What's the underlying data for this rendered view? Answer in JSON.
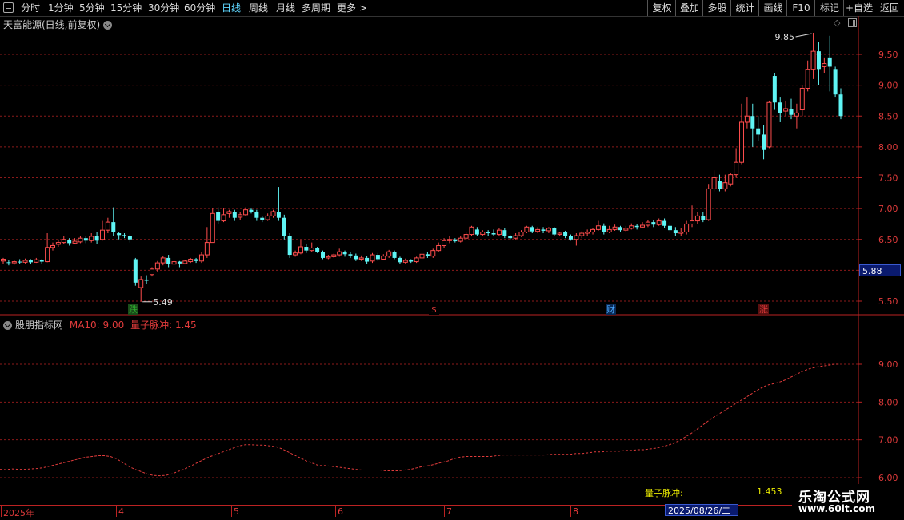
{
  "toolbar": {
    "periods": [
      "分时",
      "1分钟",
      "5分钟",
      "15分钟",
      "30分钟",
      "60分钟",
      "日线",
      "周线",
      "月线",
      "多周期",
      "更多 >"
    ],
    "active_period": "日线",
    "right_buttons": [
      "复权",
      "叠加",
      "多股",
      "统计",
      "画线",
      "F10",
      "标记",
      "+自选",
      "返回"
    ]
  },
  "main_panel": {
    "title": "天富能源(日线,前复权)",
    "high_annotation": "9.85",
    "low_annotation": "5.49",
    "current_price": "5.88",
    "y_ticks": [
      "9.50",
      "9.00",
      "8.50",
      "8.00",
      "7.50",
      "7.00",
      "6.50",
      "6.00",
      "5.50"
    ],
    "events": [
      {
        "label": "跌",
        "color": "#2ea82e",
        "bg": "#1a4d1a"
      },
      {
        "label": "$",
        "color": "#e03b3b",
        "bg": "#000"
      },
      {
        "label": "财",
        "color": "#4aa8ff",
        "bg": "#0a2a55"
      },
      {
        "label": "涨",
        "color": "#e03b3b",
        "bg": "#5a1010"
      }
    ]
  },
  "indicator_panel": {
    "name": "股朋指标网",
    "ma_label": "MA10: 9.00",
    "pulse_label": "量子脉冲: 1.45",
    "y_ticks": [
      "9.00",
      "8.00",
      "7.00",
      "6.00"
    ],
    "readout_label": "量子脉冲:",
    "readout_value": "1.453"
  },
  "date_axis": {
    "labels": [
      "2025年",
      "4",
      "5",
      "6",
      "7",
      "8"
    ],
    "cursor_date": "2025/08/26/二"
  },
  "watermark": {
    "title": "乐淘公式网",
    "url": "www.60lt.com"
  },
  "colors": {
    "up": "#ff4d4d",
    "down": "#5ff5f5",
    "grid": "#8b1a1a",
    "ma_line": "#e03b3b"
  },
  "chart_data": {
    "type": "candlestick",
    "price_range": [
      5.3,
      9.9
    ],
    "candles": [
      [
        6.15,
        6.18,
        6.1,
        6.2
      ],
      [
        6.13,
        6.12,
        6.08,
        6.16
      ],
      [
        6.12,
        6.14,
        6.09,
        6.17
      ],
      [
        6.14,
        6.13,
        6.1,
        6.18
      ],
      [
        6.13,
        6.16,
        6.11,
        6.19
      ],
      [
        6.16,
        6.13,
        6.1,
        6.18
      ],
      [
        6.13,
        6.17,
        6.12,
        6.2
      ],
      [
        6.17,
        6.14,
        6.11,
        6.18
      ],
      [
        6.14,
        6.37,
        6.13,
        6.6
      ],
      [
        6.37,
        6.4,
        6.32,
        6.45
      ],
      [
        6.42,
        6.45,
        6.38,
        6.5
      ],
      [
        6.45,
        6.5,
        6.42,
        6.55
      ],
      [
        6.49,
        6.44,
        6.4,
        6.52
      ],
      [
        6.44,
        6.47,
        6.42,
        6.52
      ],
      [
        6.46,
        6.52,
        6.44,
        6.56
      ],
      [
        6.52,
        6.48,
        6.44,
        6.55
      ],
      [
        6.48,
        6.55,
        6.45,
        6.6
      ],
      [
        6.55,
        6.48,
        6.42,
        6.62
      ],
      [
        6.5,
        6.65,
        6.48,
        6.8
      ],
      [
        6.65,
        6.78,
        6.6,
        6.85
      ],
      [
        6.78,
        6.62,
        6.55,
        7.02
      ],
      [
        6.6,
        6.57,
        6.5,
        6.62
      ],
      [
        6.57,
        6.55,
        6.52,
        6.6
      ],
      [
        6.55,
        6.5,
        6.45,
        6.58
      ],
      [
        6.18,
        5.8,
        5.75,
        6.2
      ],
      [
        5.72,
        5.85,
        5.49,
        5.9
      ],
      [
        5.85,
        5.83,
        5.78,
        5.92
      ],
      [
        5.93,
        6.02,
        5.9,
        6.05
      ],
      [
        6.02,
        6.12,
        5.98,
        6.15
      ],
      [
        6.12,
        6.2,
        6.08,
        6.23
      ],
      [
        6.2,
        6.1,
        6.05,
        6.25
      ],
      [
        6.1,
        6.14,
        6.08,
        6.17
      ],
      [
        6.14,
        6.11,
        6.05,
        6.15
      ],
      [
        6.11,
        6.15,
        6.1,
        6.17
      ],
      [
        6.14,
        6.18,
        6.12,
        6.2
      ],
      [
        6.18,
        6.15,
        6.12,
        6.2
      ],
      [
        6.15,
        6.25,
        6.12,
        6.3
      ],
      [
        6.25,
        6.45,
        6.2,
        6.7
      ],
      [
        6.45,
        6.92,
        6.45,
        7.0
      ],
      [
        6.95,
        6.8,
        6.75,
        7.02
      ],
      [
        6.8,
        6.9,
        6.78,
        7.0
      ],
      [
        6.92,
        6.95,
        6.85,
        6.98
      ],
      [
        6.95,
        6.85,
        6.8,
        6.98
      ],
      [
        6.86,
        6.9,
        6.82,
        6.95
      ],
      [
        6.9,
        6.98,
        6.88,
        7.02
      ],
      [
        6.98,
        6.95,
        6.92,
        7.0
      ],
      [
        6.95,
        6.85,
        6.8,
        6.98
      ],
      [
        6.85,
        6.82,
        6.78,
        6.88
      ],
      [
        6.82,
        6.88,
        6.8,
        6.92
      ],
      [
        6.88,
        6.95,
        6.85,
        6.98
      ],
      [
        6.95,
        6.85,
        6.8,
        7.35
      ],
      [
        6.85,
        6.55,
        6.5,
        6.9
      ],
      [
        6.55,
        6.25,
        6.2,
        6.6
      ],
      [
        6.25,
        6.28,
        6.22,
        6.32
      ],
      [
        6.28,
        6.38,
        6.26,
        6.5
      ],
      [
        6.38,
        6.32,
        6.28,
        6.42
      ],
      [
        6.32,
        6.36,
        6.3,
        6.45
      ],
      [
        6.36,
        6.3,
        6.28,
        6.38
      ],
      [
        6.3,
        6.2,
        6.18,
        6.32
      ],
      [
        6.2,
        6.22,
        6.18,
        6.25
      ],
      [
        6.22,
        6.25,
        6.2,
        6.27
      ],
      [
        6.25,
        6.3,
        6.22,
        6.35
      ],
      [
        6.3,
        6.26,
        6.22,
        6.32
      ],
      [
        6.26,
        6.24,
        6.2,
        6.3
      ],
      [
        6.24,
        6.18,
        6.15,
        6.27
      ],
      [
        6.18,
        6.2,
        6.15,
        6.24
      ],
      [
        6.2,
        6.14,
        6.1,
        6.23
      ],
      [
        6.15,
        6.25,
        6.12,
        6.28
      ],
      [
        6.25,
        6.18,
        6.15,
        6.28
      ],
      [
        6.18,
        6.23,
        6.16,
        6.26
      ],
      [
        6.23,
        6.3,
        6.2,
        6.33
      ],
      [
        6.3,
        6.2,
        6.18,
        6.32
      ],
      [
        6.2,
        6.13,
        6.1,
        6.22
      ],
      [
        6.13,
        6.16,
        6.1,
        6.19
      ],
      [
        6.16,
        6.14,
        6.12,
        6.18
      ],
      [
        6.14,
        6.2,
        6.12,
        6.22
      ],
      [
        6.2,
        6.26,
        6.18,
        6.29
      ],
      [
        6.26,
        6.23,
        6.2,
        6.29
      ],
      [
        6.23,
        6.32,
        6.2,
        6.35
      ],
      [
        6.32,
        6.4,
        6.3,
        6.45
      ],
      [
        6.4,
        6.48,
        6.36,
        6.52
      ],
      [
        6.48,
        6.5,
        6.44,
        6.55
      ],
      [
        6.5,
        6.47,
        6.45,
        6.52
      ],
      [
        6.47,
        6.52,
        6.45,
        6.55
      ],
      [
        6.52,
        6.58,
        6.5,
        6.62
      ],
      [
        6.58,
        6.7,
        6.55,
        6.72
      ],
      [
        6.66,
        6.58,
        6.55,
        6.7
      ],
      [
        6.58,
        6.62,
        6.56,
        6.65
      ],
      [
        6.62,
        6.6,
        6.56,
        6.65
      ],
      [
        6.6,
        6.58,
        6.55,
        6.66
      ],
      [
        6.58,
        6.65,
        6.56,
        6.68
      ],
      [
        6.65,
        6.55,
        6.52,
        6.68
      ],
      [
        6.55,
        6.52,
        6.5,
        6.57
      ],
      [
        6.52,
        6.56,
        6.5,
        6.6
      ],
      [
        6.56,
        6.62,
        6.54,
        6.65
      ],
      [
        6.62,
        6.7,
        6.6,
        6.72
      ],
      [
        6.7,
        6.63,
        6.6,
        6.72
      ],
      [
        6.63,
        6.66,
        6.6,
        6.7
      ],
      [
        6.66,
        6.64,
        6.6,
        6.7
      ],
      [
        6.64,
        6.68,
        6.6,
        6.7
      ],
      [
        6.68,
        6.58,
        6.55,
        6.7
      ],
      [
        6.58,
        6.6,
        6.55,
        6.62
      ],
      [
        6.62,
        6.55,
        6.52,
        6.64
      ],
      [
        6.55,
        6.5,
        6.48,
        6.58
      ],
      [
        6.5,
        6.56,
        6.4,
        6.6
      ],
      [
        6.56,
        6.6,
        6.52,
        6.63
      ],
      [
        6.6,
        6.62,
        6.56,
        6.66
      ],
      [
        6.62,
        6.66,
        6.58,
        6.68
      ],
      [
        6.66,
        6.72,
        6.64,
        6.8
      ],
      [
        6.72,
        6.62,
        6.58,
        6.76
      ],
      [
        6.62,
        6.66,
        6.6,
        6.72
      ],
      [
        6.66,
        6.7,
        6.64,
        6.74
      ],
      [
        6.7,
        6.65,
        6.62,
        6.72
      ],
      [
        6.65,
        6.68,
        6.62,
        6.72
      ],
      [
        6.68,
        6.72,
        6.66,
        6.76
      ],
      [
        6.72,
        6.7,
        6.66,
        6.75
      ],
      [
        6.7,
        6.73,
        6.68,
        6.78
      ],
      [
        6.73,
        6.78,
        6.7,
        6.82
      ],
      [
        6.78,
        6.74,
        6.7,
        6.82
      ],
      [
        6.74,
        6.8,
        6.72,
        6.84
      ],
      [
        6.8,
        6.72,
        6.68,
        6.84
      ],
      [
        6.72,
        6.65,
        6.6,
        6.78
      ],
      [
        6.65,
        6.6,
        6.55,
        6.7
      ],
      [
        6.6,
        6.62,
        6.56,
        6.68
      ],
      [
        6.62,
        6.75,
        6.58,
        6.8
      ],
      [
        6.75,
        6.8,
        6.7,
        7.05
      ],
      [
        6.8,
        6.88,
        6.75,
        6.95
      ],
      [
        6.88,
        6.82,
        6.78,
        6.94
      ],
      [
        6.82,
        7.32,
        6.8,
        7.4
      ],
      [
        7.32,
        7.5,
        7.28,
        7.62
      ],
      [
        7.45,
        7.32,
        7.28,
        7.55
      ],
      [
        7.32,
        7.42,
        7.28,
        7.55
      ],
      [
        7.4,
        7.55,
        7.36,
        7.58
      ],
      [
        7.55,
        7.75,
        7.5,
        7.98
      ],
      [
        7.75,
        8.4,
        7.72,
        8.7
      ],
      [
        8.4,
        8.5,
        8.3,
        8.8
      ],
      [
        8.5,
        8.3,
        8.0,
        8.7
      ],
      [
        8.3,
        8.2,
        8.1,
        8.5
      ],
      [
        8.2,
        7.95,
        7.8,
        8.35
      ],
      [
        8.0,
        8.72,
        7.98,
        8.75
      ],
      [
        9.15,
        8.72,
        8.6,
        9.2
      ],
      [
        8.72,
        8.55,
        8.4,
        8.8
      ],
      [
        8.58,
        8.62,
        8.5,
        8.75
      ],
      [
        8.62,
        8.52,
        8.45,
        8.78
      ],
      [
        8.5,
        8.55,
        8.3,
        8.7
      ],
      [
        8.6,
        8.95,
        8.5,
        9.0
      ],
      [
        8.95,
        9.25,
        8.9,
        9.4
      ],
      [
        9.25,
        9.55,
        9.1,
        9.85
      ],
      [
        9.55,
        9.25,
        9.0,
        9.7
      ],
      [
        9.3,
        9.35,
        9.2,
        9.45
      ],
      [
        9.45,
        9.3,
        8.9,
        9.8
      ],
      [
        9.25,
        8.85,
        8.8,
        9.3
      ],
      [
        8.85,
        8.5,
        8.45,
        8.95
      ]
    ],
    "ma10_curve": [
      6.22,
      6.21,
      6.23,
      6.22,
      6.22,
      6.23,
      6.24,
      6.26,
      6.3,
      6.34,
      6.38,
      6.42,
      6.46,
      6.5,
      6.54,
      6.56,
      6.58,
      6.58,
      6.56,
      6.5,
      6.4,
      6.3,
      6.22,
      6.16,
      6.1,
      6.06,
      6.05,
      6.06,
      6.1,
      6.16,
      6.22,
      6.3,
      6.38,
      6.46,
      6.54,
      6.6,
      6.66,
      6.72,
      6.78,
      6.84,
      6.87,
      6.87,
      6.86,
      6.86,
      6.84,
      6.82,
      6.76,
      6.68,
      6.6,
      6.52,
      6.44,
      6.38,
      6.32,
      6.32,
      6.3,
      6.28,
      6.26,
      6.24,
      6.22,
      6.2,
      6.2,
      6.2,
      6.2,
      6.18,
      6.18,
      6.18,
      6.2,
      6.22,
      6.26,
      6.3,
      6.32,
      6.36,
      6.4,
      6.44,
      6.5,
      6.54,
      6.56,
      6.56,
      6.56,
      6.56,
      6.56,
      6.58,
      6.6,
      6.6,
      6.6,
      6.6,
      6.6,
      6.6,
      6.6,
      6.6,
      6.62,
      6.62,
      6.62,
      6.62,
      6.64,
      6.64,
      6.66,
      6.68,
      6.68,
      6.7,
      6.7,
      6.7,
      6.72,
      6.72,
      6.74,
      6.74,
      6.76,
      6.78,
      6.82,
      6.86,
      6.92,
      7.0,
      7.1,
      7.2,
      7.32,
      7.44,
      7.56,
      7.66,
      7.76,
      7.86,
      7.96,
      8.06,
      8.16,
      8.26,
      8.36,
      8.44,
      8.48,
      8.52,
      8.58,
      8.66,
      8.74,
      8.82,
      8.88,
      8.92,
      8.95,
      8.97,
      9.0,
      9.0
    ],
    "ma10_range": [
      6.0,
      9.3
    ],
    "ylabel": "",
    "xlabel": ""
  }
}
